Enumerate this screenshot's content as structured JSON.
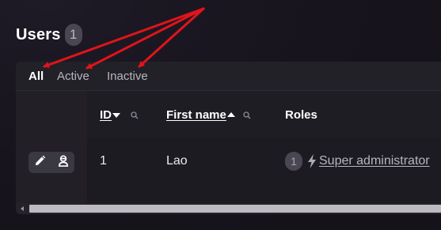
{
  "header": {
    "title": "Users",
    "count": "1"
  },
  "tabs": [
    {
      "label": "All",
      "active": true
    },
    {
      "label": "Active",
      "active": false
    },
    {
      "label": "Inactive",
      "active": false
    }
  ],
  "table": {
    "columns": [
      {
        "label": "ID",
        "sort": "desc",
        "filter": true
      },
      {
        "label": "First name",
        "sort": "asc",
        "filter": true
      },
      {
        "label": "Roles",
        "sort": null,
        "filter": false
      }
    ],
    "rows": [
      {
        "id": "1",
        "first_name": "Lao",
        "role_count": "1",
        "role_icon": "bolt-icon",
        "role": "Super administrator"
      }
    ],
    "row_actions": [
      "pencil-icon",
      "impersonate-icon"
    ]
  },
  "colors": {
    "background": "#17131c",
    "panel": "#1d1b22",
    "text": "#ffffff",
    "muted": "#b8b5bf",
    "badge": "#4a4752",
    "annotation_arrow": "#e0141a"
  }
}
